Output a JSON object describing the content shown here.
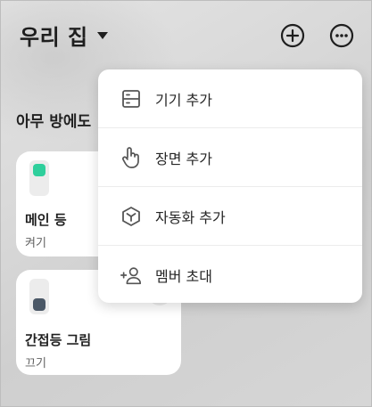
{
  "header": {
    "title": "우리 집",
    "dropdown_icon": "caret-down-icon",
    "add_icon": "plus-circle-icon",
    "more_icon": "more-circle-icon"
  },
  "section": {
    "title": "아무 방에도"
  },
  "devices": [
    {
      "name": "메인 등",
      "state": "켜기",
      "knob_color": "#2fcf9c"
    },
    {
      "name": "간접등 그림",
      "state": "끄기",
      "knob_color": "#4a5766"
    }
  ],
  "menu": {
    "items": [
      {
        "label": "기기 추가",
        "icon": "device-add-icon"
      },
      {
        "label": "장면 추가",
        "icon": "tap-hand-icon"
      },
      {
        "label": "자동화 추가",
        "icon": "automation-hexagon-icon"
      },
      {
        "label": "멤버 초대",
        "icon": "add-member-icon"
      }
    ]
  },
  "colors": {
    "text": "#1e1e1e",
    "accent_on": "#2fcf9c",
    "accent_off": "#4a5766",
    "icon": "#555555"
  }
}
